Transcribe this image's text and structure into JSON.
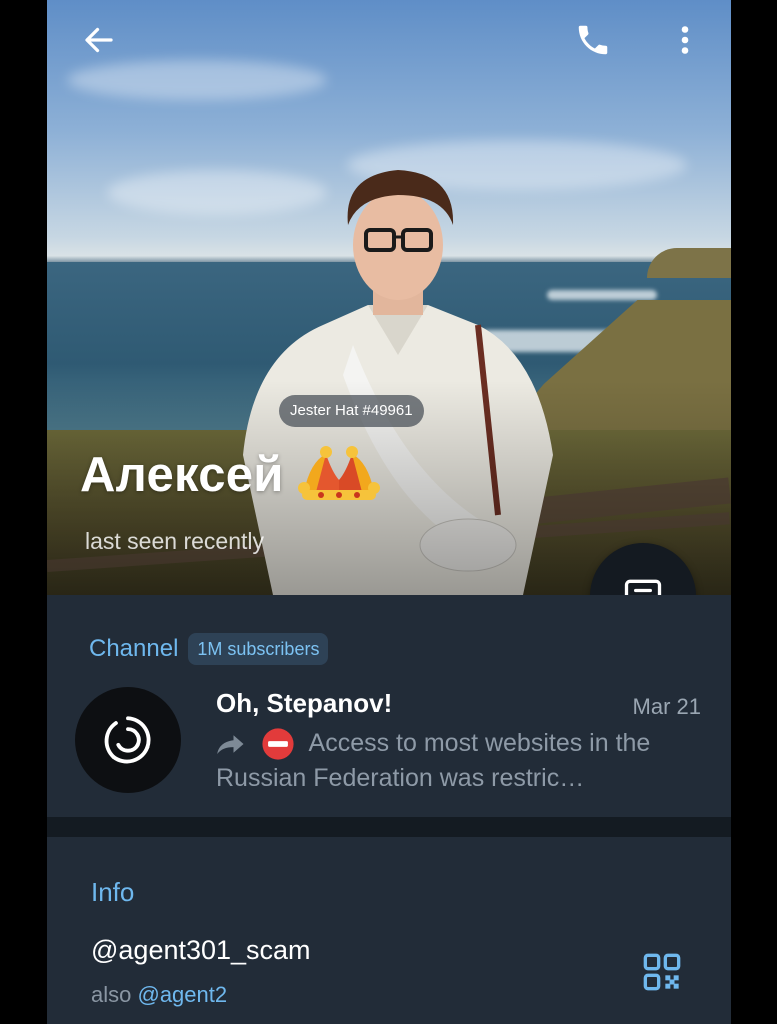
{
  "profile": {
    "name": "Алексей",
    "status": "last seen recently",
    "gift_badge": "Jester Hat #49961",
    "emoji_status": "jester-hat"
  },
  "toolbar": {
    "back_icon": "arrow-left-icon",
    "call_icon": "phone-icon",
    "menu_icon": "more-vertical-icon"
  },
  "fab": {
    "icon": "message-icon"
  },
  "channel": {
    "section_label": "Channel",
    "subscribers_badge": "1M subscribers",
    "name": "Oh, Stepanov!",
    "date": "Mar 21",
    "preview": "Access to most websites in the Russian Federation was restric…",
    "forward_icon": "forward-icon",
    "no_entry_icon": "no-entry-icon"
  },
  "info": {
    "section_label": "Info",
    "username": "@agent301_scam",
    "also_prefix": "also",
    "also_username": "@agent2",
    "qr_icon": "qr-code-icon"
  },
  "colors": {
    "accent": "#6fb8ee",
    "panel": "#222c38",
    "divider": "#141b22"
  }
}
